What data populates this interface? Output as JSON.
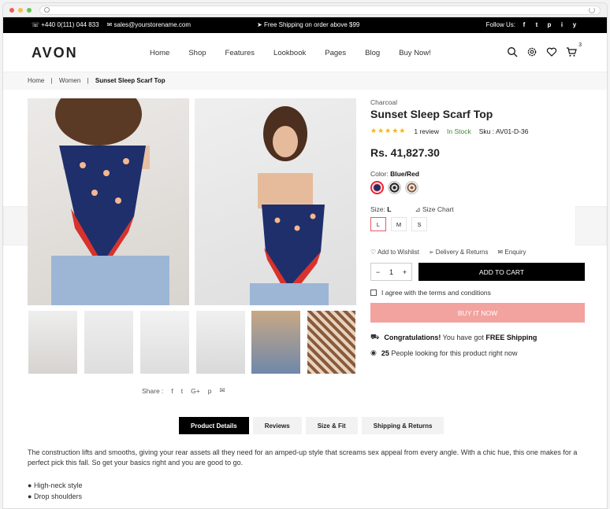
{
  "topbar": {
    "phone": "+440 0(111) 044 833",
    "email": "sales@yourstorename.com",
    "shipping": "Free Shipping on order above $99",
    "follow": "Follow Us:",
    "social": [
      "f",
      "t",
      "p",
      "i",
      "y"
    ]
  },
  "header": {
    "logo": "AVON",
    "nav": [
      "Home",
      "Shop",
      "Features",
      "Lookbook",
      "Pages",
      "Blog",
      "Buy Now!"
    ],
    "cart_count": "3"
  },
  "breadcrumb": {
    "items": [
      "Home",
      "Women"
    ],
    "current": "Sunset Sleep Scarf Top",
    "sep": "|"
  },
  "product": {
    "brand": "Charcoal",
    "title": "Sunset Sleep Scarf Top",
    "stars": "★★★★★",
    "reviews": "1 review",
    "stock": "In Stock",
    "sku_label": "Sku :",
    "sku": "AV01-D-36",
    "price": "Rs. 41,827.30",
    "color_label": "Color:",
    "color_value": "Blue/Red",
    "size_label": "Size:",
    "size_value": "L",
    "size_chart": "Size Chart",
    "sizes": [
      "L",
      "M",
      "S"
    ],
    "wishlist": "Add to Wishlist",
    "delivery": "Delivery & Returns",
    "enquiry": "Enquiry",
    "qty": "1",
    "add_to_cart": "ADD TO CART",
    "agree": "I agree with the terms and conditions",
    "buy_now": "BUY IT NOW",
    "congrats_bold": "Congratulations!",
    "congrats_text": "You have got",
    "free_ship": "FREE Shipping",
    "people_count": "25",
    "people_text": "People looking for this product right now"
  },
  "share": {
    "label": "Share :"
  },
  "tabs": [
    "Product Details",
    "Reviews",
    "Size & Fit",
    "Shipping & Returns"
  ],
  "description": "The construction lifts and smooths, giving your rear assets all they need for an amped-up style that screams sex appeal from every angle. With a chic hue, this one makes for a perfect pick this fall. So get your basics right and you are good to go.",
  "bullets": [
    "High-neck style",
    "Drop shoulders"
  ]
}
